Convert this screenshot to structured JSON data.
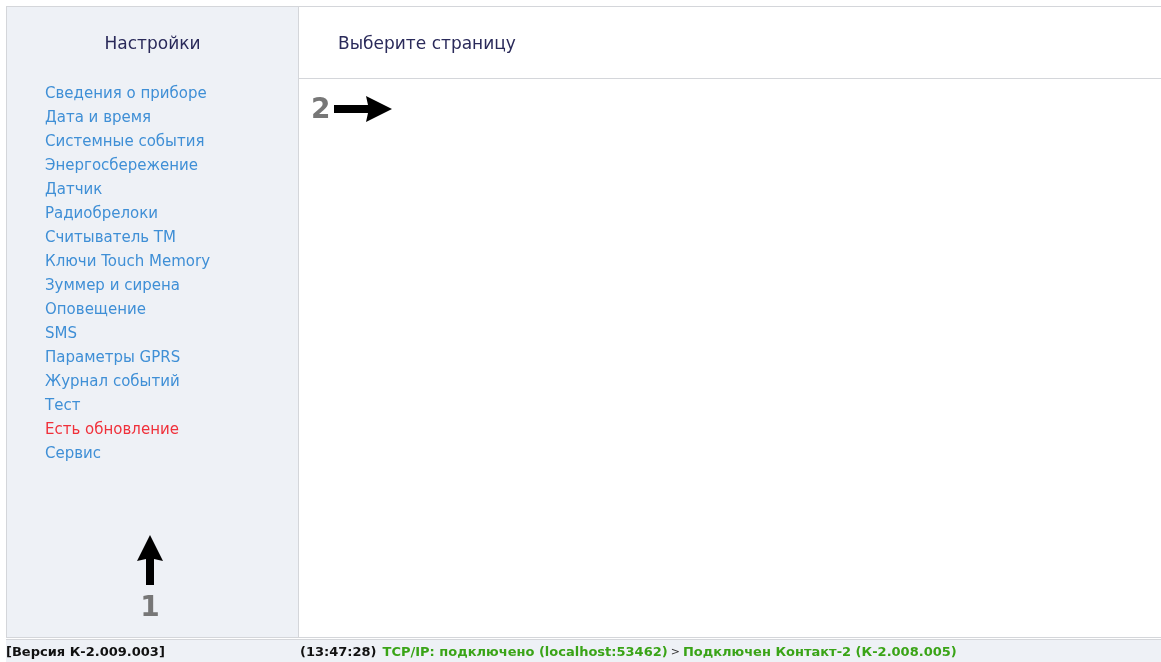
{
  "sidebar": {
    "title": "Настройки",
    "items": [
      {
        "label": "Сведения о приборе",
        "kind": "normal"
      },
      {
        "label": "Дата и время",
        "kind": "normal"
      },
      {
        "label": "Системные события",
        "kind": "normal"
      },
      {
        "label": "Энергосбережение",
        "kind": "normal"
      },
      {
        "label": "Датчик",
        "kind": "normal"
      },
      {
        "label": "Радиобрелоки",
        "kind": "normal"
      },
      {
        "label": "Считыватель ТМ",
        "kind": "normal"
      },
      {
        "label": "Ключи Touch Memory",
        "kind": "normal"
      },
      {
        "label": "Зуммер и сирена",
        "kind": "normal"
      },
      {
        "label": "Оповещение",
        "kind": "normal"
      },
      {
        "label": "SMS",
        "kind": "normal"
      },
      {
        "label": "Параметры GPRS",
        "kind": "normal"
      },
      {
        "label": "Журнал событий",
        "kind": "normal"
      },
      {
        "label": "Тест",
        "kind": "normal"
      },
      {
        "label": "Есть обновление",
        "kind": "alert"
      },
      {
        "label": "Сервис",
        "kind": "normal"
      }
    ]
  },
  "main": {
    "title": "Выберите страницу"
  },
  "annotations": [
    {
      "label": "1",
      "kind": "up"
    },
    {
      "label": "2",
      "kind": "right"
    }
  ],
  "status_bar": {
    "version": "[Версия К-2.009.003]",
    "time": "(13:47:28)",
    "connection": "TCP/IP: подключено (localhost:53462)",
    "separator": ">",
    "device": "Подключен Контакт-2 (К-2.008.005)"
  }
}
